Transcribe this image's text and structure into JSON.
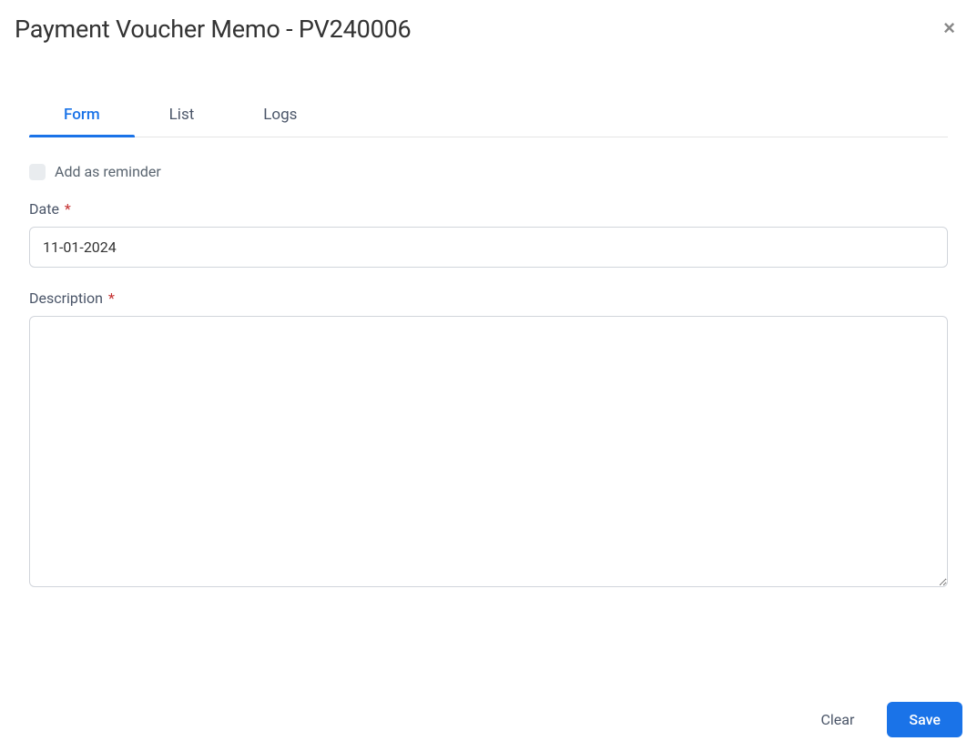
{
  "modal": {
    "title": "Payment Voucher Memo - PV240006"
  },
  "tabs": [
    {
      "label": "Form",
      "active": true
    },
    {
      "label": "List",
      "active": false
    },
    {
      "label": "Logs",
      "active": false
    }
  ],
  "form": {
    "reminder_label": "Add as reminder",
    "reminder_checked": false,
    "date_label": "Date",
    "date_value": "11-01-2024",
    "description_label": "Description",
    "description_value": ""
  },
  "footer": {
    "clear_label": "Clear",
    "save_label": "Save"
  }
}
